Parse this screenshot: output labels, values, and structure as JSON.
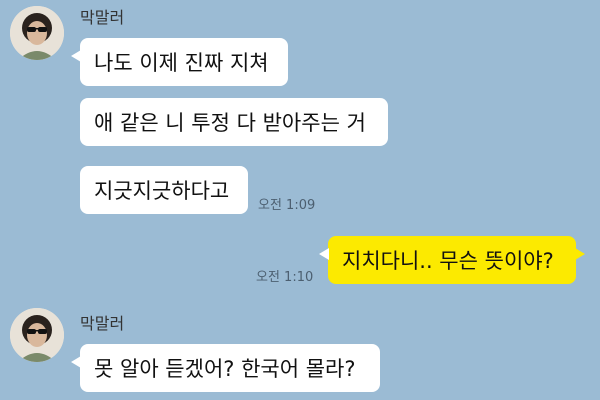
{
  "chat": {
    "groups": [
      {
        "sender": "막말러",
        "messages": [
          "나도 이제 진짜 지쳐",
          "애 같은 니 투정 다 받아주는 거",
          "지긋지긋하다고"
        ],
        "time": "오전 1:09"
      },
      {
        "sender": "막말러",
        "messages": [
          "못 알아 듣겠어? 한국어 몰라?"
        ]
      }
    ],
    "outgoing": {
      "message": "지치다니.. 무슨 뜻이야?",
      "time": "오전 1:10"
    }
  },
  "colors": {
    "background": "#9bbbd4",
    "incoming_bubble": "#ffffff",
    "outgoing_bubble": "#fcea00"
  },
  "icons": [
    "profile-avatar"
  ]
}
